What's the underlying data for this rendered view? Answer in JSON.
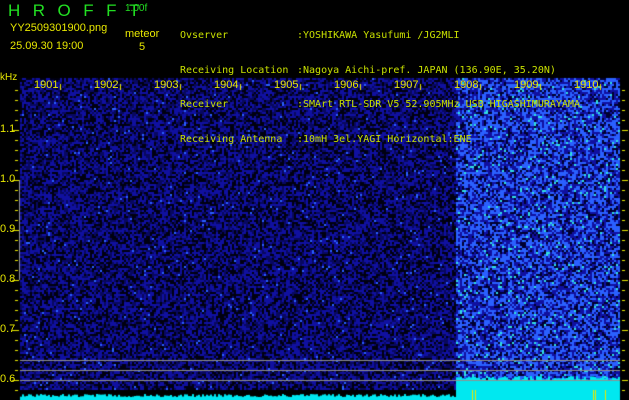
{
  "header": {
    "app_title": "HROFFT",
    "version": "1.00f",
    "filename": "YY2509301900.png",
    "datetime": "25.09.30 19:00",
    "meteor_label": "meteor",
    "meteor_count": "5"
  },
  "station_info": [
    {
      "label": "Ovserver",
      "value": ":YOSHIKAWA Yasufumi /JG2MLI"
    },
    {
      "label": "Receiving Location",
      "value": ":Nagoya Aichi-pref. JAPAN (136.90E, 35.20N)"
    },
    {
      "label": "Receiver",
      "value": ":SMArt RTL-SDR V5 52.905MHz USB HIGASHIMURAYAMA"
    },
    {
      "label": "Receiving Antenna",
      "value": ":10mH 3el.YAGI Horizontal:ENE"
    }
  ],
  "chart_data": {
    "type": "heatmap",
    "ylabel": "kHz",
    "ylim": [
      0.57,
      1.2
    ],
    "y_ticks": [
      "1.1",
      "1.0",
      "0.9",
      "0.8",
      "0.7",
      "0.6"
    ],
    "x_tick_labels": [
      "1901",
      "1902",
      "1903",
      "1904",
      "1905",
      "1906",
      "1907",
      "1908",
      "1909",
      "1910"
    ],
    "x_range_minutes": [
      0,
      10
    ],
    "high_noise_start_minute": 7.4,
    "reference_lines_khz": [
      0.62,
      0.6,
      0.58
    ],
    "colors": {
      "background": "#000000",
      "low": "#1010a0",
      "high": "#2a60ff",
      "peak": "#30e0e0",
      "text": "#e8e800",
      "title": "#22e022",
      "baseline": "#00e8f0",
      "ref_line": "#909090"
    }
  }
}
